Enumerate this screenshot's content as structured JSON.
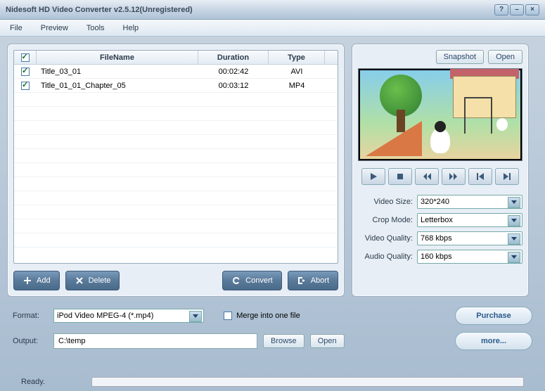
{
  "titlebar": {
    "title": "Nidesoft HD Video Converter v2.5.12(Unregistered)"
  },
  "menu": {
    "file": "File",
    "preview": "Preview",
    "tools": "Tools",
    "help": "Help"
  },
  "table": {
    "headers": {
      "filename": "FileName",
      "duration": "Duration",
      "type": "Type"
    },
    "rows": [
      {
        "checked": true,
        "name": "Title_03_01",
        "duration": "00:02:42",
        "type": "AVI"
      },
      {
        "checked": true,
        "name": "Title_01_01_Chapter_05",
        "duration": "00:03:12",
        "type": "MP4"
      }
    ]
  },
  "actions": {
    "add": "Add",
    "delete": "Delete",
    "convert": "Convert",
    "abort": "Abort"
  },
  "preview": {
    "snapshot": "Snapshot",
    "open": "Open"
  },
  "settings": {
    "video_size_label": "Video Size:",
    "video_size": "320*240",
    "crop_mode_label": "Crop Mode:",
    "crop_mode": "Letterbox",
    "video_quality_label": "Video Quality:",
    "video_quality": "768 kbps",
    "audio_quality_label": "Audio Quality:",
    "audio_quality": "160 kbps"
  },
  "format": {
    "label": "Format:",
    "value": "iPod Video MPEG-4 (*.mp4)"
  },
  "output": {
    "label": "Output:",
    "value": "C:\\temp",
    "browse": "Browse",
    "open": "Open"
  },
  "merge": {
    "label": "Merge into one file"
  },
  "buttons": {
    "purchase": "Purchase",
    "more": "more..."
  },
  "status": {
    "text": "Ready."
  }
}
